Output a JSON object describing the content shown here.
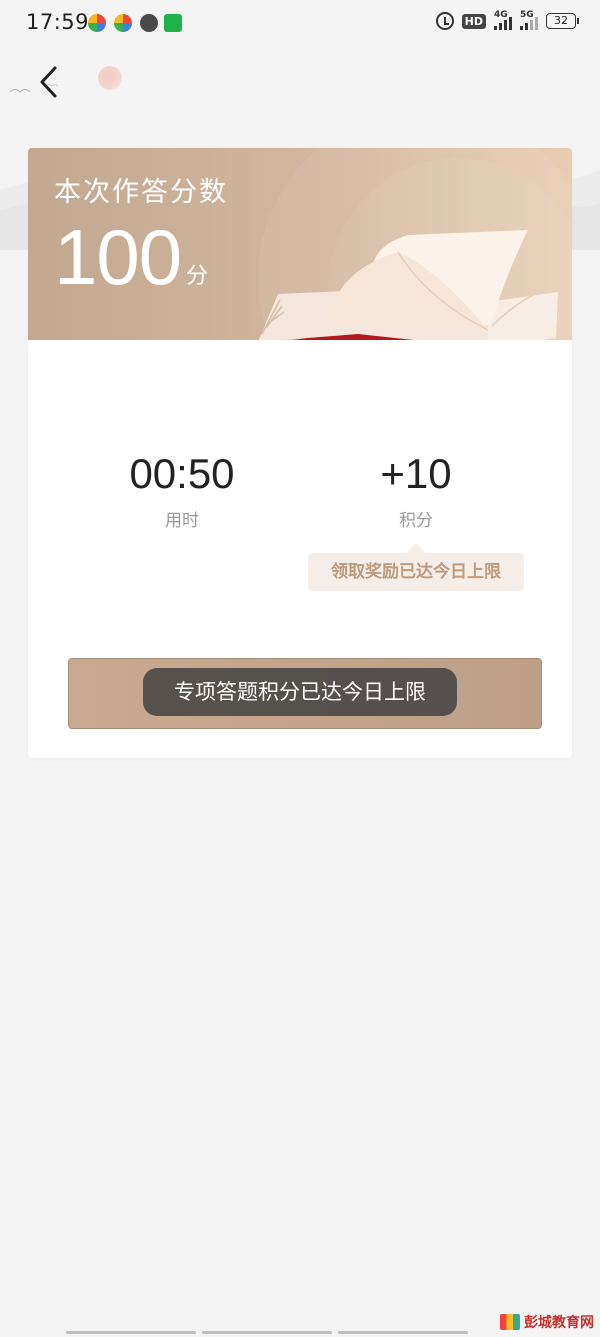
{
  "status_bar": {
    "time": "17:59",
    "network_1": "4G",
    "network_2": "5G",
    "battery": "32"
  },
  "result": {
    "score_label": "本次作答分数",
    "score_value": "100",
    "score_unit": "分"
  },
  "stats": {
    "time_value": "00:50",
    "time_label": "用时",
    "points_value": "+10",
    "points_label": "积分"
  },
  "tip": "领取奖励已达今日上限",
  "toast": "专项答题积分已达今日上限",
  "watermark": "彭城教育网",
  "colors": {
    "banner": "#c3a891",
    "button": "#c8aa91",
    "tip_text": "#c09a7c"
  }
}
